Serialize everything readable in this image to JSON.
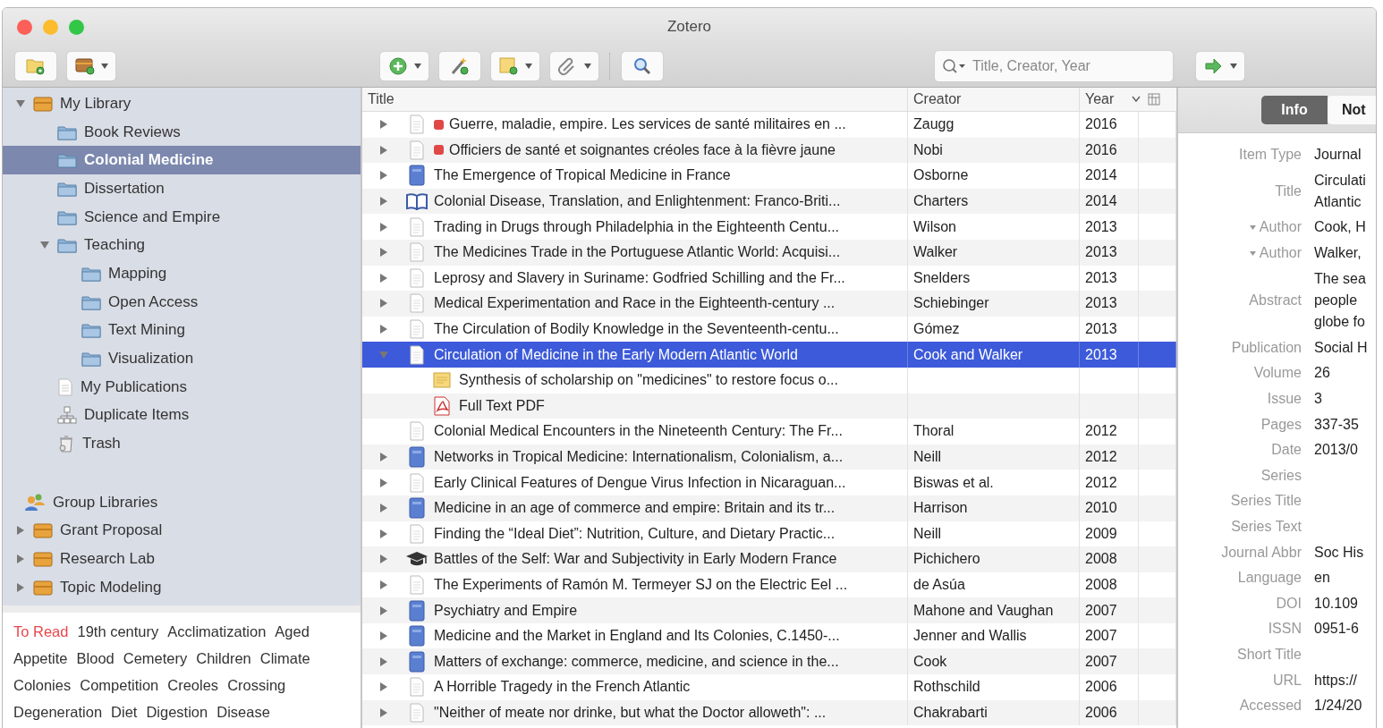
{
  "window": {
    "title": "Zotero"
  },
  "toolbar": {
    "left": [
      {
        "kind": "new-collection",
        "menu": false
      },
      {
        "kind": "new-library",
        "menu": true
      }
    ],
    "middle": [
      {
        "kind": "new-item",
        "menu": true
      },
      {
        "kind": "wand",
        "menu": false
      },
      {
        "kind": "new-note",
        "menu": true
      },
      {
        "kind": "attach",
        "menu": true
      },
      {
        "kind": "separator"
      },
      {
        "kind": "advanced-search",
        "menu": false
      }
    ],
    "search": {
      "placeholder": "Title, Creator, Year"
    },
    "right": [
      {
        "kind": "locate",
        "menu": true
      }
    ]
  },
  "collections": [
    {
      "label": "My Library",
      "kind": "library",
      "expanded": true,
      "selected": false,
      "children": [
        {
          "label": "Book Reviews",
          "kind": "folder",
          "selected": false
        },
        {
          "label": "Colonial Medicine",
          "kind": "folder",
          "selected": true
        },
        {
          "label": "Dissertation",
          "kind": "folder",
          "selected": false
        },
        {
          "label": "Science and Empire",
          "kind": "folder",
          "selected": false
        },
        {
          "label": "Teaching",
          "kind": "folder",
          "expanded": true,
          "selected": false,
          "children": [
            {
              "label": "Mapping",
              "kind": "folder",
              "selected": false
            },
            {
              "label": "Open Access",
              "kind": "folder",
              "selected": false
            },
            {
              "label": "Text Mining",
              "kind": "folder",
              "selected": false
            },
            {
              "label": "Visualization",
              "kind": "folder",
              "selected": false
            }
          ]
        },
        {
          "label": "My Publications",
          "kind": "publications",
          "selected": false
        },
        {
          "label": "Duplicate Items",
          "kind": "duplicates",
          "selected": false
        },
        {
          "label": "Trash",
          "kind": "trash",
          "selected": false
        }
      ]
    }
  ],
  "group_libraries": {
    "label": "Group Libraries",
    "items": [
      {
        "label": "Grant Proposal",
        "kind": "library",
        "expanded": false,
        "selected": false
      },
      {
        "label": "Research Lab",
        "kind": "library",
        "expanded": false,
        "selected": false
      },
      {
        "label": "Topic Modeling",
        "kind": "library",
        "expanded": false,
        "selected": false
      }
    ]
  },
  "tags": [
    {
      "label": "To Read",
      "color": "#e8474c"
    },
    {
      "label": "19th century"
    },
    {
      "label": "Acclimatization"
    },
    {
      "label": "Aged"
    },
    {
      "label": "Appetite"
    },
    {
      "label": "Blood"
    },
    {
      "label": "Cemetery"
    },
    {
      "label": "Children"
    },
    {
      "label": "Climate"
    },
    {
      "label": "Colonies"
    },
    {
      "label": "Competition"
    },
    {
      "label": "Creoles"
    },
    {
      "label": "Crossing"
    },
    {
      "label": "Degeneration"
    },
    {
      "label": "Diet"
    },
    {
      "label": "Digestion"
    },
    {
      "label": "Disease"
    }
  ],
  "items_table": {
    "columns": [
      "Title",
      "Creator",
      "Year"
    ],
    "rows": [
      {
        "title": "Guerre, maladie, empire. Les services de santé militaires en ...",
        "creator": "Zaugg",
        "year": "2016",
        "kind": "document",
        "expanded": false,
        "selected": false,
        "color": "#e04848"
      },
      {
        "title": "Officiers de santé et soignantes créoles face à la fièvre jaune",
        "creator": "Nobi",
        "year": "2016",
        "kind": "document",
        "expanded": false,
        "selected": false,
        "color": "#e04848"
      },
      {
        "title": "The Emergence of Tropical Medicine in France",
        "creator": "Osborne",
        "year": "2014",
        "kind": "book",
        "expanded": false,
        "selected": false
      },
      {
        "title": "Colonial Disease, Translation, and Enlightenment: Franco-Briti...",
        "creator": "Charters",
        "year": "2014",
        "kind": "book-section",
        "expanded": false,
        "selected": false
      },
      {
        "title": "Trading in Drugs through Philadelphia in the Eighteenth Centu...",
        "creator": "Wilson",
        "year": "2013",
        "kind": "document",
        "expanded": false,
        "selected": false
      },
      {
        "title": "The Medicines Trade in the Portuguese Atlantic World: Acquisi...",
        "creator": "Walker",
        "year": "2013",
        "kind": "document",
        "expanded": false,
        "selected": false
      },
      {
        "title": "Leprosy and Slavery in Suriname: Godfried Schilling and the Fr...",
        "creator": "Snelders",
        "year": "2013",
        "kind": "document",
        "expanded": false,
        "selected": false
      },
      {
        "title": "Medical Experimentation and Race in the Eighteenth-century ...",
        "creator": "Schiebinger",
        "year": "2013",
        "kind": "document",
        "expanded": false,
        "selected": false
      },
      {
        "title": "The Circulation of Bodily Knowledge in the Seventeenth-centu...",
        "creator": "Gómez",
        "year": "2013",
        "kind": "document",
        "expanded": false,
        "selected": false
      },
      {
        "title": "Circulation of Medicine in the Early Modern Atlantic World",
        "creator": "Cook and Walker",
        "year": "2013",
        "kind": "document",
        "expanded": true,
        "selected": true,
        "children": [
          {
            "title": "Synthesis of scholarship on \"medicines\" to restore focus o...",
            "kind": "note",
            "selected": false
          },
          {
            "title": "Full Text PDF",
            "kind": "pdf",
            "selected": false
          }
        ]
      },
      {
        "title": "Colonial Medical Encounters in the Nineteenth Century: The Fr...",
        "creator": "Thoral",
        "year": "2012",
        "kind": "document",
        "selected": false
      },
      {
        "title": "Networks in Tropical Medicine: Internationalism, Colonialism, a...",
        "creator": "Neill",
        "year": "2012",
        "kind": "book",
        "expanded": false,
        "selected": false
      },
      {
        "title": "Early Clinical Features of Dengue Virus Infection in Nicaraguan...",
        "creator": "Biswas et al.",
        "year": "2012",
        "kind": "document",
        "expanded": false,
        "selected": false
      },
      {
        "title": "Medicine in an age of commerce and empire: Britain and its tr...",
        "creator": "Harrison",
        "year": "2010",
        "kind": "book",
        "expanded": false,
        "selected": false
      },
      {
        "title": "Finding the “Ideal Diet”: Nutrition, Culture, and Dietary Practic...",
        "creator": "Neill",
        "year": "2009",
        "kind": "document",
        "expanded": false,
        "selected": false
      },
      {
        "title": "Battles of the Self: War and Subjectivity in Early Modern France",
        "creator": "Pichichero",
        "year": "2008",
        "kind": "thesis",
        "expanded": false,
        "selected": false
      },
      {
        "title": "The Experiments of Ramón M. Termeyer SJ on the Electric Eel ...",
        "creator": "de Asúa",
        "year": "2008",
        "kind": "document",
        "expanded": false,
        "selected": false
      },
      {
        "title": "Psychiatry and Empire",
        "creator": "Mahone and Vaughan",
        "year": "2007",
        "kind": "book",
        "expanded": false,
        "selected": false
      },
      {
        "title": "Medicine and the Market in England and Its Colonies, C.1450-...",
        "creator": "Jenner and Wallis",
        "year": "2007",
        "kind": "book",
        "expanded": false,
        "selected": false
      },
      {
        "title": "Matters of exchange: commerce, medicine, and science in the...",
        "creator": "Cook",
        "year": "2007",
        "kind": "book",
        "expanded": false,
        "selected": false
      },
      {
        "title": "A Horrible Tragedy in the French Atlantic",
        "creator": "Rothschild",
        "year": "2006",
        "kind": "document",
        "expanded": false,
        "selected": false
      },
      {
        "title": "\"Neither of meate nor drinke, but what the Doctor alloweth\": ...",
        "creator": "Chakrabarti",
        "year": "2006",
        "kind": "document",
        "expanded": false,
        "selected": false
      }
    ]
  },
  "item_pane": {
    "tabs": [
      {
        "label": "Info",
        "selected": true
      },
      {
        "label": "Not",
        "selected": false
      }
    ],
    "fields": [
      {
        "label": "Item Type",
        "kind": "field",
        "lines": [
          "Journal"
        ]
      },
      {
        "label": "Title",
        "kind": "field",
        "lines": [
          "Circulati",
          "Atlantic"
        ]
      },
      {
        "label": "Author",
        "kind": "creator",
        "lines": [
          "Cook, H"
        ]
      },
      {
        "label": "Author",
        "kind": "creator",
        "lines": [
          "Walker,"
        ]
      },
      {
        "label": "Abstract",
        "kind": "field",
        "lines": [
          "The sea",
          "people",
          "globe fo"
        ]
      },
      {
        "label": "Publication",
        "kind": "field",
        "lines": [
          "Social H"
        ]
      },
      {
        "label": "Volume",
        "kind": "field",
        "lines": [
          "26"
        ]
      },
      {
        "label": "Issue",
        "kind": "field",
        "lines": [
          "3"
        ]
      },
      {
        "label": "Pages",
        "kind": "field",
        "lines": [
          "337-35"
        ]
      },
      {
        "label": "Date",
        "kind": "field",
        "lines": [
          "2013/0"
        ]
      },
      {
        "label": "Series",
        "kind": "field"
      },
      {
        "label": "Series Title",
        "kind": "field"
      },
      {
        "label": "Series Text",
        "kind": "field"
      },
      {
        "label": "Journal Abbr",
        "kind": "field",
        "lines": [
          "Soc His"
        ]
      },
      {
        "label": "Language",
        "kind": "field",
        "lines": [
          "en"
        ]
      },
      {
        "label": "DOI",
        "kind": "field",
        "lines": [
          "10.109"
        ]
      },
      {
        "label": "ISSN",
        "kind": "field",
        "lines": [
          "0951-6"
        ]
      },
      {
        "label": "Short Title",
        "kind": "field"
      },
      {
        "label": "URL",
        "kind": "field",
        "lines": [
          "https://"
        ]
      },
      {
        "label": "Accessed",
        "kind": "field",
        "lines": [
          "1/24/20"
        ]
      }
    ]
  }
}
